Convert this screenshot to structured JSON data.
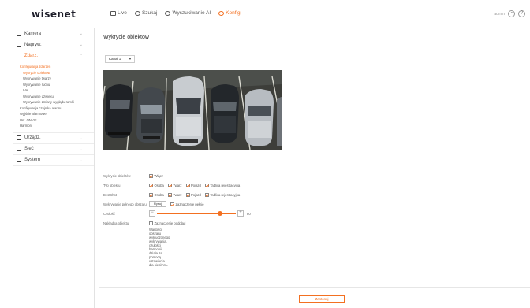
{
  "brand": {
    "logo": "wisenet",
    "accent": "#f37021"
  },
  "topnav": {
    "items": [
      {
        "label": "Live",
        "icon": "monitor-icon"
      },
      {
        "label": "Szukaj",
        "icon": "search-icon"
      },
      {
        "label": "Wyszukiwanie AI",
        "icon": "ai-search-icon"
      },
      {
        "label": "Konfig",
        "icon": "gear-icon",
        "active": true
      }
    ],
    "user": "admin",
    "icons": [
      "user-icon",
      "help-icon"
    ]
  },
  "sidebar": {
    "sections": [
      {
        "label": "Kamera",
        "icon": "camera-icon"
      },
      {
        "label": "Nagryw.",
        "icon": "record-icon"
      },
      {
        "label": "Zdarz.",
        "icon": "event-icon",
        "open": true
      }
    ],
    "event_items": [
      {
        "label": "Konfiguracja zdarzeń",
        "level": 1,
        "active": true
      },
      {
        "label": "Wykrycie obiektów",
        "level": 2,
        "active": true
      },
      {
        "label": "Wykrywanie twarzy",
        "level": 2
      },
      {
        "label": "Wykrywanie ruchu",
        "level": 2
      },
      {
        "label": "IVA",
        "level": 2
      },
      {
        "label": "Wykrywanie dźwięku",
        "level": 2
      },
      {
        "label": "Wykrywanie zmiany wyglądu ramki",
        "level": 2
      },
      {
        "label": "Konfiguracja czujnika alarmu",
        "level": 1
      },
      {
        "label": "Wyjście alarmowe",
        "level": 1
      },
      {
        "label": "Ust. ONVIF",
        "level": 1
      },
      {
        "label": "Harmon.",
        "level": 1
      }
    ],
    "lower_sections": [
      {
        "label": "Urządz.",
        "icon": "device-icon"
      },
      {
        "label": "Sieć",
        "icon": "network-icon"
      },
      {
        "label": "System",
        "icon": "system-icon"
      }
    ]
  },
  "main": {
    "title": "Wykrycie obiektów",
    "channel": "Kanał 1",
    "form": {
      "enable_label": "Wykrycie obiektów",
      "enable_value": "Włącz",
      "type_label": "Typ obiektu",
      "types": [
        "Osoba",
        "Twarz",
        "Pojazd",
        "Tablica rejestracyjna"
      ],
      "bestshot_label": "BestShot",
      "bestshot": [
        "Osoba",
        "Twarz",
        "Pojazd",
        "Tablica rejestracyjna"
      ],
      "area_label": "Wykrywanie pełnego obszaru",
      "area_button": "Rysuj",
      "area_check": "Zaznaczenie pełnie",
      "sensitivity_label": "Czułość",
      "sensitivity_value": "80",
      "sensitivity_level": 0.8,
      "preview_label": "Nakładka obiektu",
      "preview_check": "Zaznaczenie podgląd",
      "preview_hint": "Wartości obszaru wykluczonego wykrywania, czułości i harmonii działa za pomocą ustawienia dla sieci/IVA."
    },
    "apply_label": "Zastosuj"
  }
}
